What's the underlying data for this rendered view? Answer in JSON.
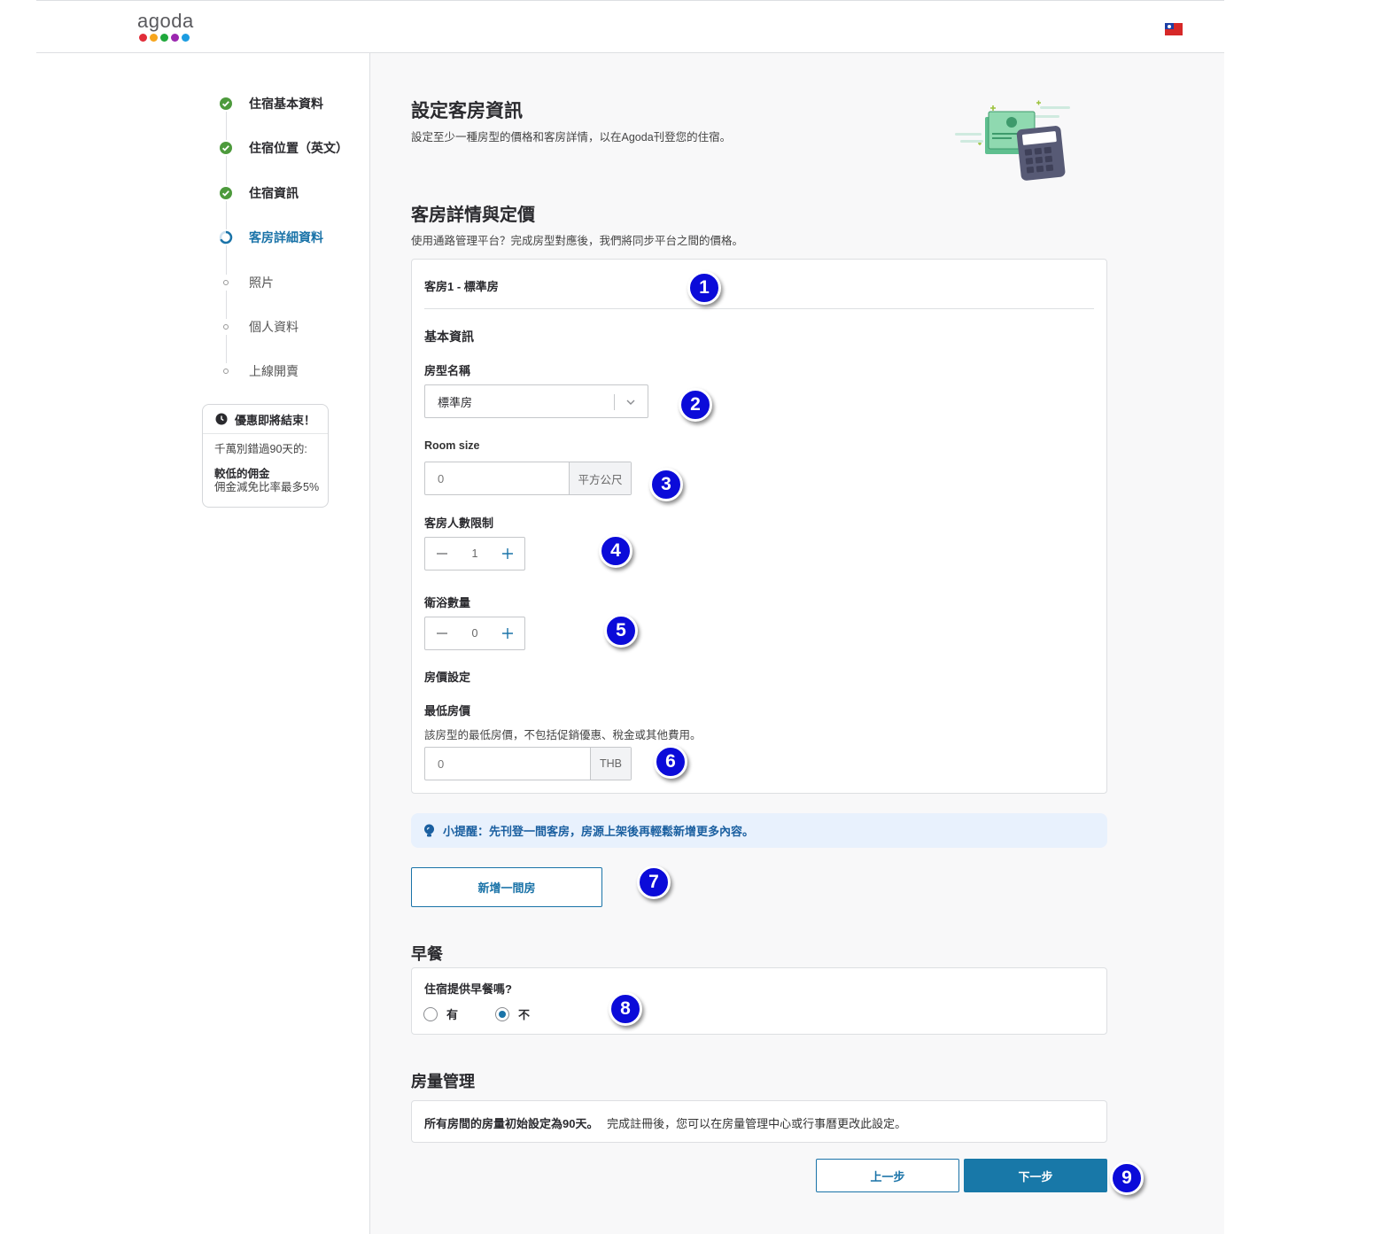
{
  "header": {
    "logo_text": "agoda",
    "logo_colors": [
      "#e12d39",
      "#f7a51c",
      "#1fa83b",
      "#9b27af",
      "#1b9ce1"
    ],
    "flag": "taiwan-flag-icon"
  },
  "sidebar": {
    "steps": [
      {
        "label": "住宿基本資料",
        "status": "done"
      },
      {
        "label": "住宿位置（英文）",
        "status": "done"
      },
      {
        "label": "住宿資訊",
        "status": "done"
      },
      {
        "label": "客房詳細資料",
        "status": "current"
      },
      {
        "label": "照片",
        "status": "pending"
      },
      {
        "label": "個人資料",
        "status": "pending"
      },
      {
        "label": "上線開賣",
        "status": "pending"
      }
    ],
    "promo": {
      "title": "優惠即將結束！",
      "line1": "千萬別錯過90天的:",
      "strong": "較低的佣金",
      "line2": "佣金減免比率最多5%"
    }
  },
  "main": {
    "title": "設定客房資訊",
    "subtitle": "設定至少一種房型的價格和客房詳情，以在Agoda刊登您的住宿。",
    "section_title": "客房詳情與定價",
    "section_subtitle": "使用通路管理平台？完成房型對應後，我們將同步平台之間的價格。",
    "room": {
      "header": "客房1 - 標準房",
      "basic_info": "基本資訊",
      "room_type_label": "房型名稱",
      "room_type_value": "標準房",
      "room_size_label": "Room size",
      "room_size_value": "0",
      "room_size_unit": "平方公尺",
      "guests_label": "客房人數限制",
      "guests_value": "1",
      "bath_label": "衛浴數量",
      "bath_value": "0",
      "pricing_label": "房價設定",
      "min_price_label": "最低房價",
      "min_price_desc": "該房型的最低房價，不包括促銷優惠、稅金或其他費用。",
      "min_price_value": "0",
      "min_price_unit": "THB"
    },
    "tip": "小提醒：先刊登一間客房，房源上架後再輕鬆新增更多內容。",
    "add_room_button": "新增一間房",
    "breakfast": {
      "title": "早餐",
      "question": "住宿提供早餐嗎?",
      "options": [
        "有",
        "不"
      ],
      "selected": "不"
    },
    "inventory": {
      "title": "房量管理",
      "bold_text": "所有房間的房量初始設定為90天。",
      "text": "完成註冊後，您可以在房量管理中心或行事曆更改此設定。"
    },
    "prev_button": "上一步",
    "next_button": "下一步"
  },
  "annotations": [
    "1",
    "2",
    "3",
    "4",
    "5",
    "6",
    "7",
    "8",
    "9"
  ],
  "colors": {
    "accent": "#1a73a8",
    "primary_button": "#1878a8",
    "done_check": "#4d9a3c",
    "tip_bg": "#e8f1fd",
    "annotation": "#0b0bd9"
  }
}
